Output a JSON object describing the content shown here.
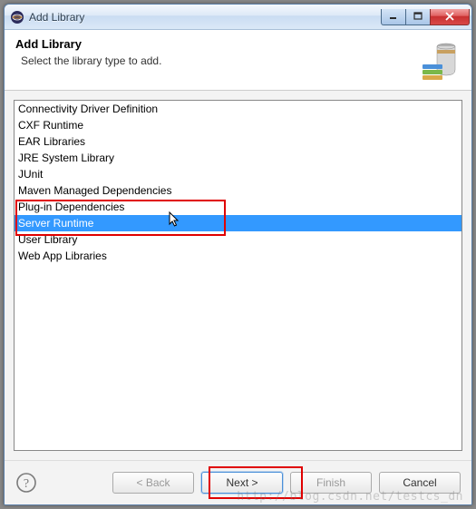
{
  "window": {
    "title": "Add Library"
  },
  "header": {
    "title": "Add Library",
    "description": "Select the library type to add."
  },
  "list": {
    "items": [
      "Connectivity Driver Definition",
      "CXF Runtime",
      "EAR Libraries",
      "JRE System Library",
      "JUnit",
      "Maven Managed Dependencies",
      "Plug-in Dependencies",
      "Server Runtime",
      "User Library",
      "Web App Libraries"
    ],
    "selected_index": 7
  },
  "buttons": {
    "back": "< Back",
    "next": "Next >",
    "finish": "Finish",
    "cancel": "Cancel"
  },
  "watermark": "http://blog.csdn.net/testcs_dn"
}
